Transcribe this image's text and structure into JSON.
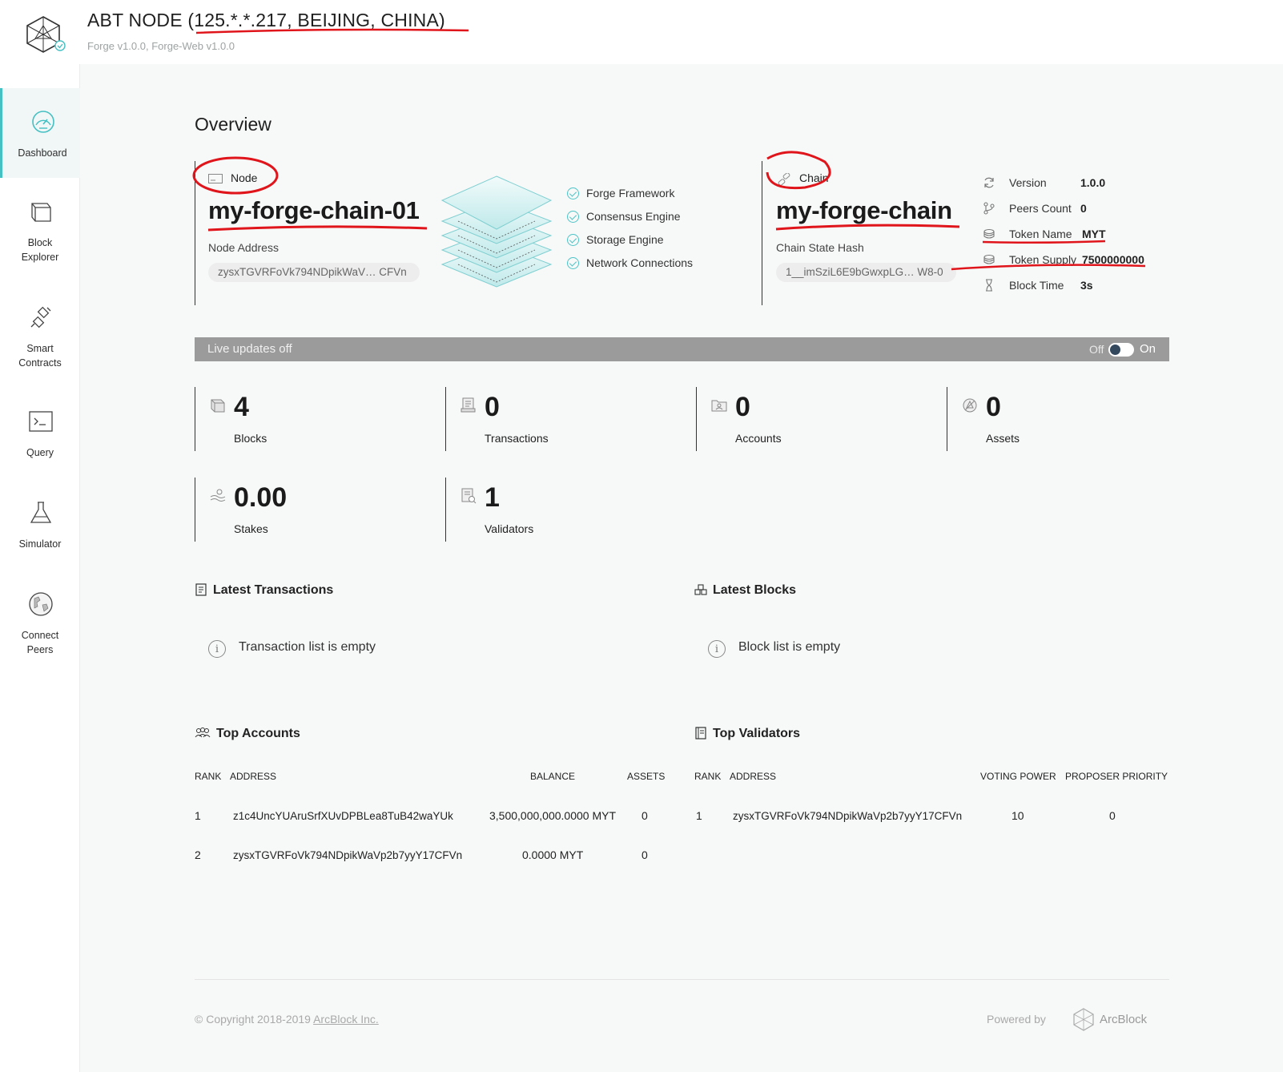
{
  "header": {
    "title": "ABT NODE (125.*.*.217, BEIJING, CHINA)",
    "subtitle": "Forge v1.0.0, Forge-Web v1.0.0",
    "logo_icon": "arcblock-logo-icon"
  },
  "sidebar": {
    "items": [
      {
        "label": "Dashboard",
        "icon": "dashboard-gauge-icon",
        "active": true
      },
      {
        "label": "Block\nExplorer",
        "icon": "cube-icon"
      },
      {
        "label": "Smart\nContracts",
        "icon": "plug-icon"
      },
      {
        "label": "Query",
        "icon": "terminal-icon"
      },
      {
        "label": "Simulator",
        "icon": "flask-icon"
      },
      {
        "label": "Connect\nPeers",
        "icon": "globe-icon"
      }
    ]
  },
  "overview": {
    "title": "Overview",
    "node": {
      "tag": "Node",
      "name": "my-forge-chain-01",
      "address_label": "Node Address",
      "address": "zysxTGVRFoVk794NDpikWaV… CFVn"
    },
    "features": [
      "Forge Framework",
      "Consensus Engine",
      "Storage Engine",
      "Network Connections"
    ],
    "chain": {
      "tag": "Chain",
      "name": "my-forge-chain",
      "hash_label": "Chain State Hash",
      "hash": "1__imSziL6E9bGwxpLG… W8-0"
    },
    "info": [
      {
        "key": "Version",
        "value": "1.0.0",
        "icon": "refresh-icon"
      },
      {
        "key": "Peers Count",
        "value": "0",
        "icon": "branch-icon"
      },
      {
        "key": "Token Name",
        "value": "MYT",
        "icon": "coins-icon"
      },
      {
        "key": "Token Supply",
        "value": "7500000000",
        "icon": "coins-icon"
      },
      {
        "key": "Block Time",
        "value": "3s",
        "icon": "hourglass-icon"
      }
    ]
  },
  "live": {
    "text": "Live updates off",
    "off_label": "Off",
    "on_label": "On",
    "enabled": false
  },
  "stats": [
    {
      "value": "4",
      "label": "Blocks",
      "icon": "block-icon"
    },
    {
      "value": "0",
      "label": "Transactions",
      "icon": "receipt-icon"
    },
    {
      "value": "0",
      "label": "Accounts",
      "icon": "folder-user-icon"
    },
    {
      "value": "0",
      "label": "Assets",
      "icon": "asset-icon"
    },
    {
      "value": "0.00",
      "label": "Stakes",
      "icon": "stake-icon"
    },
    {
      "value": "1",
      "label": "Validators",
      "icon": "validator-icon"
    }
  ],
  "latest_transactions": {
    "title": "Latest Transactions",
    "empty": "Transaction list is empty"
  },
  "latest_blocks": {
    "title": "Latest Blocks",
    "empty": "Block list is empty"
  },
  "top_accounts": {
    "title": "Top Accounts",
    "columns": [
      "RANK",
      "ADDRESS",
      "BALANCE",
      "ASSETS"
    ],
    "rows": [
      {
        "rank": "1",
        "address": "z1c4UncYUAruSrfXUvDPBLea8TuB42waYUk",
        "balance": "3,500,000,000.0000 MYT",
        "assets": "0"
      },
      {
        "rank": "2",
        "address": "zysxTGVRFoVk794NDpikWaVp2b7yyY17CFVn",
        "balance": "0.0000 MYT",
        "assets": "0"
      }
    ]
  },
  "top_validators": {
    "title": "Top Validators",
    "columns": [
      "RANK",
      "ADDRESS",
      "VOTING POWER",
      "PROPOSER PRIORITY"
    ],
    "rows": [
      {
        "rank": "1",
        "address": "zysxTGVRFoVk794NDpikWaVp2b7yyY17CFVn",
        "voting_power": "10",
        "proposer_priority": "0"
      }
    ]
  },
  "footer": {
    "copyright": "© Copyright 2018-2019",
    "company": "ArcBlock Inc.",
    "powered": "Powered by",
    "brand": "ArcBlock"
  },
  "colors": {
    "accent": "#45c0c3",
    "annotation": "#e0151b",
    "live_bar": "#9b9b9b"
  }
}
